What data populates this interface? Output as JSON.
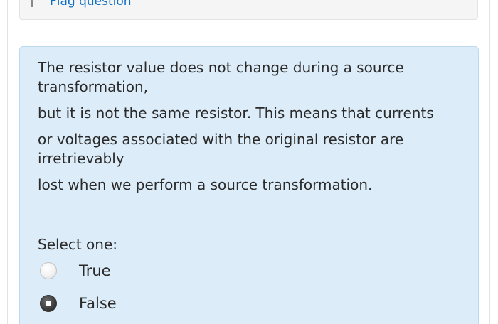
{
  "flag": {
    "label": "Flag question",
    "icon": "flag-icon"
  },
  "question": {
    "paragraphs": [
      "The resistor value does not change during a source transformation,",
      "but it is not the same resistor. This means that currents",
      "or voltages associated with the original resistor are irretrievably",
      "lost when we perform a source transformation."
    ],
    "prompt": "Select one:",
    "options": [
      {
        "label": "True",
        "selected": false
      },
      {
        "label": "False",
        "selected": true
      }
    ]
  },
  "colors": {
    "content_bg": "#dcecf8",
    "link": "#0f6fc5"
  }
}
